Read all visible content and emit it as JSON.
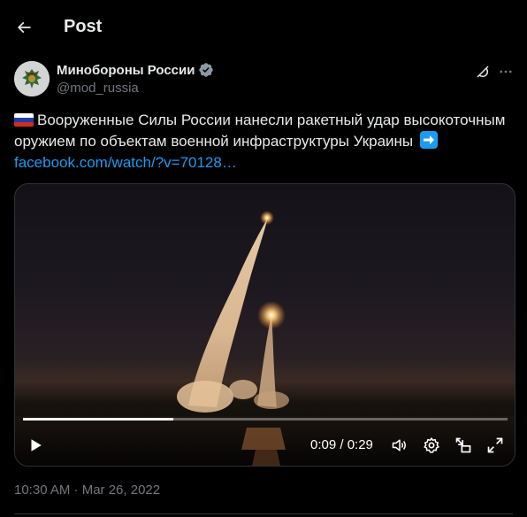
{
  "header": {
    "title": "Post",
    "back_icon": "arrow-left-icon"
  },
  "author": {
    "name": "Минобороны России",
    "handle": "@mod_russia",
    "verified_icon": "verified-badge-icon",
    "avatar_icon": "emblem-avatar-icon"
  },
  "actions": {
    "grok_icon": "grok-icon",
    "more_icon": "more-dots-icon"
  },
  "post": {
    "flag_emoji": "russia-flag-icon",
    "text": "Вооруженные Силы России нанесли ракетный удар высокоточным оружием по объектам военной инфраструктуры Украины",
    "arrow_emoji": "right-arrow-emoji-icon",
    "link_text": "facebook.com/watch/?v=70128…"
  },
  "video": {
    "progress_fraction": 0.31,
    "time_text": "0:09 / 0:29",
    "play_icon": "play-icon",
    "volume_icon": "volume-icon",
    "settings_icon": "gear-icon",
    "dock_icon": "dock-icon",
    "fullscreen_icon": "fullscreen-icon"
  },
  "meta": {
    "timestamp": "10:30 AM · Mar 26, 2022"
  },
  "colors": {
    "background": "#000000",
    "text": "#e7e9ea",
    "secondary_text": "#71767b",
    "link": "#1d9bf0",
    "border": "#2f3336"
  }
}
